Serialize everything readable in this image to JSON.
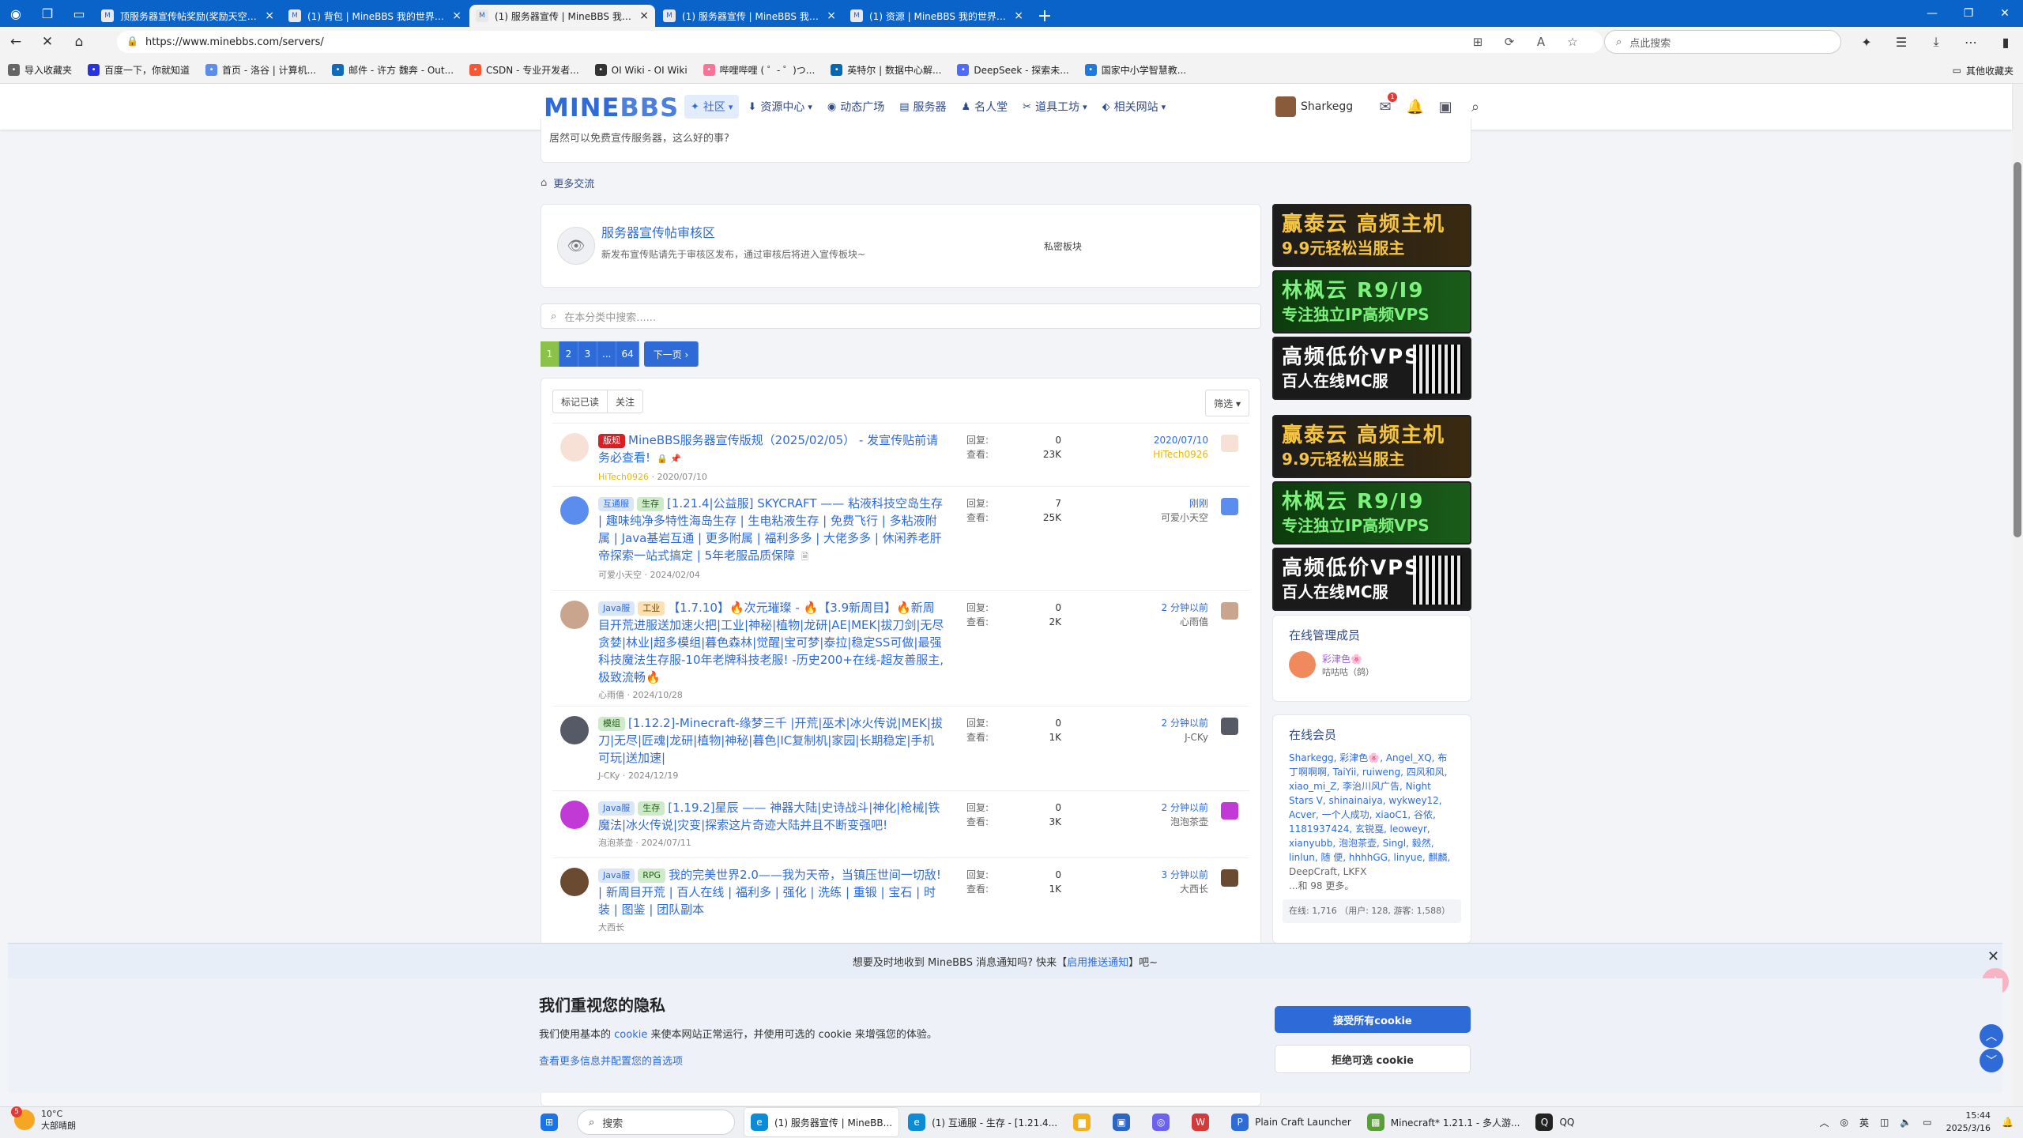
{
  "browser": {
    "tabs": [
      {
        "title": "顶服务器宣传帖奖励(奖励天空点卡...",
        "active": false
      },
      {
        "title": "(1) 背包 | MineBBS 我的世界中文...",
        "active": false
      },
      {
        "title": "(1) 服务器宣传 | MineBBS 我的世界...",
        "active": true
      },
      {
        "title": "(1) 服务器宣传 | MineBBS 我的世界...",
        "active": false
      },
      {
        "title": "(1) 资源 | MineBBS 我的世界中文...",
        "active": false
      }
    ],
    "url": "https://www.minebbs.com/servers/",
    "search_placeholder": "点此搜索",
    "favorites": [
      {
        "label": "导入收藏夹",
        "color": "#666666"
      },
      {
        "label": "百度一下，你就知道",
        "color": "#2932e1"
      },
      {
        "label": "首页 - 洛谷 | 计算机...",
        "color": "#5b8def"
      },
      {
        "label": "邮件 - 许方 魏奔 - Out...",
        "color": "#0f6cbd"
      },
      {
        "label": "CSDN - 专业开发者...",
        "color": "#fc5531"
      },
      {
        "label": "OI Wiki - OI Wiki",
        "color": "#333333"
      },
      {
        "label": "哔哩哔哩 ( ゜- ゜)つ...",
        "color": "#fb7299"
      },
      {
        "label": "英特尔 | 数据中心解...",
        "color": "#0068b5"
      },
      {
        "label": "DeepSeek - 探索未...",
        "color": "#4d6bfe"
      },
      {
        "label": "国家中小学智慧教...",
        "color": "#1f7ae0"
      }
    ],
    "other_favorites": "其他收藏夹"
  },
  "site": {
    "logo_a": "MINE",
    "logo_b": "BBS",
    "nav": [
      {
        "label": "社区",
        "icon": "✦",
        "dropdown": true,
        "active": true
      },
      {
        "label": "资源中心",
        "icon": "⬇",
        "dropdown": true,
        "active": false
      },
      {
        "label": "动态广场",
        "icon": "◉",
        "dropdown": false,
        "active": false
      },
      {
        "label": "服务器",
        "icon": "▤",
        "dropdown": false,
        "active": false
      },
      {
        "label": "名人堂",
        "icon": "♟",
        "dropdown": false,
        "active": false
      },
      {
        "label": "道具工坊",
        "icon": "✂",
        "dropdown": true,
        "active": false
      },
      {
        "label": "相关网站",
        "icon": "⬖",
        "dropdown": true,
        "active": false
      }
    ],
    "username": "Sharkegg",
    "notice_badge": "1"
  },
  "content": {
    "top_text": "居然可以免费宣传服务器，这么好的事?",
    "more_exchange": "更多交流",
    "subforum": {
      "title": "服务器宣传帖审核区",
      "desc": "新发布宣传贴请先于审核区发布，通过审核后将进入宣传板块~",
      "tag": "私密板块"
    },
    "search_placeholder": "在本分类中搜索......",
    "pages": [
      "1",
      "2",
      "3",
      "...",
      "64"
    ],
    "next_page": "下一页 ›",
    "filter_buttons": [
      "标记已读",
      "关注"
    ],
    "filter_menu": "筛选 ▾",
    "stat_labels": {
      "reply": "回复:",
      "view": "查看:"
    },
    "threads": [
      {
        "prefixes": [
          {
            "text": "版规",
            "style": "red"
          }
        ],
        "title": "MineBBS服务器宣传版规（2025/02/05） - 发宣传贴前请务必查看!",
        "author": "HiTech0926",
        "date": "2020/07/10",
        "replies": "0",
        "views": "23K",
        "last_date": "2020/07/10",
        "last_user": "HiTech0926",
        "last_user_gold": true,
        "icons": "🔒 📌",
        "avatar": "#f7e1d7",
        "avatar2": "#f7e1d7"
      },
      {
        "prefixes": [
          {
            "text": "互通服",
            "style": "blue"
          },
          {
            "text": "生存",
            "style": "green"
          }
        ],
        "title": "[1.21.4|公益服] SKYCRAFT —— 粘液科技空岛生存 | 趣味纯净多特性海岛生存 | 生电粘液生存 | 免费飞行 | 多粘液附属 | Java基岩互通 | 更多附属 | 福利多多 | 大佬多多 | 休闲养老肝帝探索一站式搞定 | 5年老服品质保障",
        "author": "可爱小天空",
        "date": "2024/02/04",
        "replies": "7",
        "views": "25K",
        "last_date": "刚刚",
        "last_user": "可爱小天空",
        "last_user_gold": false,
        "icons": "🗎",
        "avatar": "#5b8def",
        "avatar2": "#5b8def"
      },
      {
        "prefixes": [
          {
            "text": "Java服",
            "style": "blue"
          },
          {
            "text": "工业",
            "style": "orange"
          }
        ],
        "title": "【1.7.10】🔥次元璀璨 - 🔥【3.9新周目】🔥新周目开荒进服送加速火把|工业|神秘|植物|龙研|AE|MEK|拔刀剑|无尽贪婪|林业|超多模组|暮色森林|觉醒|宝可梦|泰拉|稳定SS可做|最强科技魔法生存服-10年老牌科技老服! -历史200+在线-超友善服主,极致流畅🔥",
        "author": "心雨僖",
        "date": "2024/10/28",
        "replies": "0",
        "views": "2K",
        "last_date": "2 分钟以前",
        "last_user": "心雨僖",
        "last_user_gold": false,
        "icons": "",
        "avatar": "#c9a58e",
        "avatar2": "#c9a58e"
      },
      {
        "prefixes": [
          {
            "text": "模组",
            "style": "green"
          }
        ],
        "title": "[1.12.2]-Minecraft-缘梦三千 |开荒|巫术|冰火传说|MEK|拔刀|无尽|匠魂|龙研|植物|神秘|暮色|IC复制机|家园|长期稳定|手机可玩|送加速|",
        "author": "J-CKy",
        "date": "2024/12/19",
        "replies": "0",
        "views": "1K",
        "last_date": "2 分钟以前",
        "last_user": "J-CKy",
        "last_user_gold": false,
        "icons": "",
        "avatar": "#555a66",
        "avatar2": "#555a66"
      },
      {
        "prefixes": [
          {
            "text": "Java服",
            "style": "blue"
          },
          {
            "text": "生存",
            "style": "green"
          }
        ],
        "title": "[1.19.2]星辰 —— 神器大陆|史诗战斗|神化|枪械|铁魔法|冰火传说|灾变|探索这片奇迹大陆并且不断变强吧!",
        "author": "泡泡茶壶",
        "date": "2024/07/11",
        "replies": "0",
        "views": "3K",
        "last_date": "2 分钟以前",
        "last_user": "泡泡茶壶",
        "last_user_gold": false,
        "icons": "",
        "avatar": "#c23ad6",
        "avatar2": "#c23ad6"
      },
      {
        "prefixes": [
          {
            "text": "Java服",
            "style": "blue"
          },
          {
            "text": "RPG",
            "style": "green"
          }
        ],
        "title": "我的完美世界2.0——我为天帝，当镇压世间一切敌! | 新周目开荒 | 百人在线 | 福利多 | 强化 | 洗练 | 重锻 | 宝石 | 时装 | 图鉴 | 团队副本",
        "author": "大西长",
        "date": "",
        "replies": "0",
        "views": "1K",
        "last_date": "3 分钟以前",
        "last_user": "大西长",
        "last_user_gold": false,
        "icons": "",
        "avatar": "#6b4a32",
        "avatar2": "#6b4a32"
      }
    ]
  },
  "sidebar": {
    "ads": [
      {
        "l1": "赢泰云 高频主机",
        "l2": "9.9元轻松当服主",
        "style": "gold"
      },
      {
        "l1": "林枫云   R9/I9",
        "l2": "专注独立IP高频VPS",
        "style": "green"
      },
      {
        "l1": "高频低价VPS",
        "l2": "百人在线MC服",
        "style": "dark"
      },
      {
        "l1": "赢泰云 高频主机",
        "l2": "9.9元轻松当服主",
        "style": "gold"
      },
      {
        "l1": "林枫云   R9/I9",
        "l2": "专注独立IP高频VPS",
        "style": "green"
      },
      {
        "l1": "高频低价VPS",
        "l2": "百人在线MC服",
        "style": "dark"
      }
    ],
    "staff_title": "在线管理成员",
    "staff_name": "彩津色🌸",
    "staff_role": "咕咕咕（鸽）",
    "members_title": "在线会员",
    "members_text": "Sharkegg, 彩津色🌸, Angel_XQ, 布丁啊啊啊, TaiYii, ruiweng, 四风和风, xiao_mi_Z, 李治川风广告, Night Stars V, shinainaiya, wykwey12, Acver, 一个人成功, xiaoC1, 谷侬, 1181937424, 玄锐戛, leoweyr, xianyubb, 泡泡茶壶, Singl, 毅然, linlun, 随 便, hhhhGG, linyue, 麒麟,",
    "members_more": "DeepCraft, LKFX\n...和 98 更多。",
    "online_count": "在线: 1,716 （用户: 128, 游客: 1,588）"
  },
  "push": {
    "text_a": "想要及时地收到 MineBBS 消息通知吗? 快来【",
    "link": "启用推送通知",
    "text_b": "】吧~"
  },
  "cookie": {
    "title": "我们重视您的隐私",
    "text_a": "我们使用基本的 ",
    "text_link": "cookie",
    "text_b": " 来使本网站正常运行，并使用可选的 cookie 来增强您的体验。",
    "settings_link": "查看更多信息并配置您的首选项",
    "accept": "接受所有cookie",
    "reject": "拒绝可选 cookie"
  },
  "taskbar": {
    "temp": "10°C",
    "weather": "大部晴朗",
    "weather_badge": "5",
    "search": "搜索",
    "apps": [
      {
        "label": "(1) 服务器宣传 | MineBB...",
        "color": "#0c8bd6",
        "glyph": "e",
        "running": true
      },
      {
        "label": "(1) 互通服 - 生存 - [1.21.4...",
        "color": "#0c8bd6",
        "glyph": "e",
        "running": false
      },
      {
        "label": "",
        "color": "#f2b01e",
        "glyph": "▆",
        "running": false
      },
      {
        "label": "",
        "color": "#2b66c4",
        "glyph": "▣",
        "running": false
      },
      {
        "label": "",
        "color": "#6b63f0",
        "glyph": "◎",
        "running": false
      },
      {
        "label": "",
        "color": "#d13b3b",
        "glyph": "W",
        "running": false
      },
      {
        "label": "Plain Craft Launcher",
        "color": "#2f6bd7",
        "glyph": "P",
        "running": false
      },
      {
        "label": "Minecraft* 1.21.1 - 多人游...",
        "color": "#5a9e3a",
        "glyph": "▩",
        "running": false
      },
      {
        "label": "QQ",
        "color": "#222222",
        "glyph": "Q",
        "running": false
      }
    ],
    "lang": "英",
    "time": "15:44",
    "date": "2025/3/16"
  }
}
